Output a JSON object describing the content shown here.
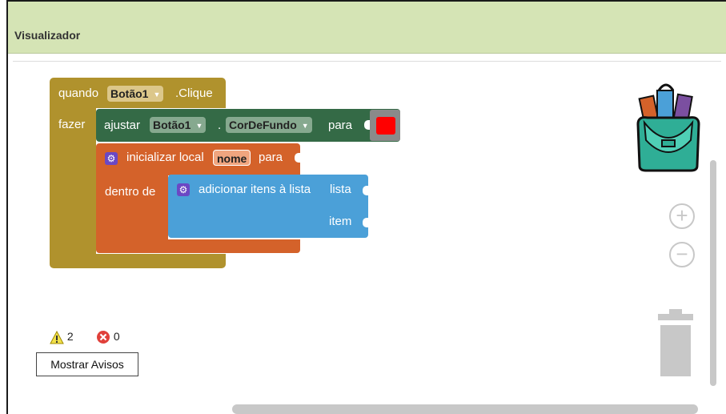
{
  "panel": {
    "title": "Visualizador"
  },
  "event_block": {
    "when_label": "quando",
    "component": "Botão1",
    "event": ".Clique",
    "do_label": "fazer"
  },
  "set_block": {
    "set_label": "ajustar",
    "component": "Botão1",
    "dot": ".",
    "property": "CorDeFundo",
    "to_label": "para",
    "color_value": "#ff0000"
  },
  "local_block": {
    "init_label": "inicializar local",
    "var_name": "nome",
    "to_label": "para",
    "in_label": "dentro de"
  },
  "list_block": {
    "title": "adicionar itens à lista",
    "list_label": "lista",
    "item_label": "item"
  },
  "warnings": {
    "warning_count": "2",
    "error_count": "0",
    "show_button": "Mostrar Avisos"
  },
  "icons": [
    "warning-icon",
    "error-icon",
    "backpack-icon",
    "zoom-in-icon",
    "zoom-out-icon",
    "trash-icon",
    "gear-icon"
  ],
  "colors": {
    "event": "#b0922d",
    "set": "#346a46",
    "local": "#d4622a",
    "list": "#4ba0d8",
    "header": "#d5e4b5"
  }
}
